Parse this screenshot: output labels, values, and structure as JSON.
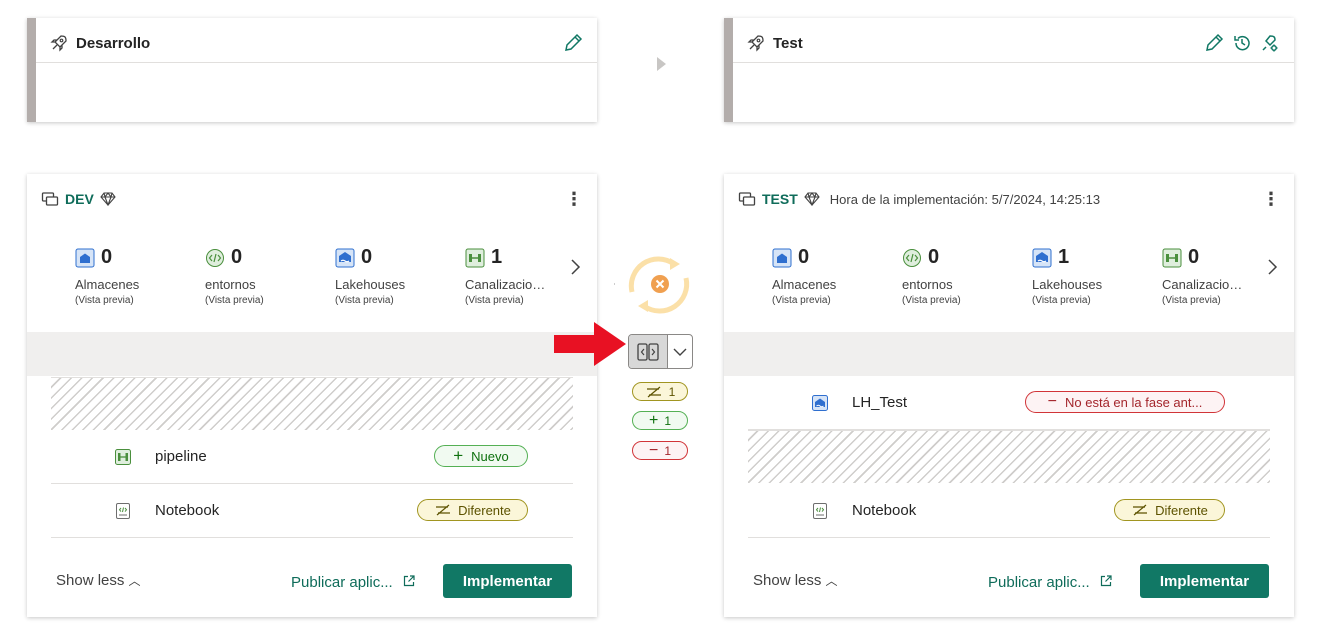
{
  "stages": [
    {
      "name": "Desarrollo"
    },
    {
      "name": "Test"
    }
  ],
  "workspaces": [
    {
      "name": "DEV",
      "deploy_time": "",
      "stats": [
        {
          "count": "0",
          "label": "Almacenes",
          "sub": "(Vista previa)"
        },
        {
          "count": "0",
          "label": "entornos",
          "sub": "(Vista previa)"
        },
        {
          "count": "0",
          "label": "Lakehouses",
          "sub": "(Vista previa)"
        },
        {
          "count": "1",
          "label": "Canalizaciones",
          "sub": "(Vista previa)"
        }
      ],
      "items": [
        {
          "name": "pipeline",
          "status": "Nuevo"
        },
        {
          "name": "Notebook",
          "status": "Diferente"
        }
      ],
      "show_less": "Show less",
      "publish": "Publicar aplic...",
      "deploy": "Implementar"
    },
    {
      "name": "TEST",
      "deploy_time": "Hora de la implementación: 5/7/2024, 14:25:13",
      "stats": [
        {
          "count": "0",
          "label": "Almacenes",
          "sub": "(Vista previa)"
        },
        {
          "count": "0",
          "label": "entornos",
          "sub": "(Vista previa)"
        },
        {
          "count": "1",
          "label": "Lakehouses",
          "sub": "(Vista previa)"
        },
        {
          "count": "0",
          "label": "Canalizaciones",
          "sub": "(Vista previa)"
        }
      ],
      "items": [
        {
          "name": "LH_Test",
          "status": "No está en la fase ant..."
        },
        {
          "name": "Notebook",
          "status": "Diferente"
        }
      ],
      "show_less": "Show less",
      "publish": "Publicar aplic...",
      "deploy": "Implementar"
    }
  ],
  "compare": {
    "different_count": "1",
    "new_count": "1",
    "missing_count": "1"
  },
  "colors": {
    "accent": "#117865",
    "workspace_name": "#0f6c5a",
    "arrow": "#e81123",
    "sync_orange": "#f7c873"
  }
}
